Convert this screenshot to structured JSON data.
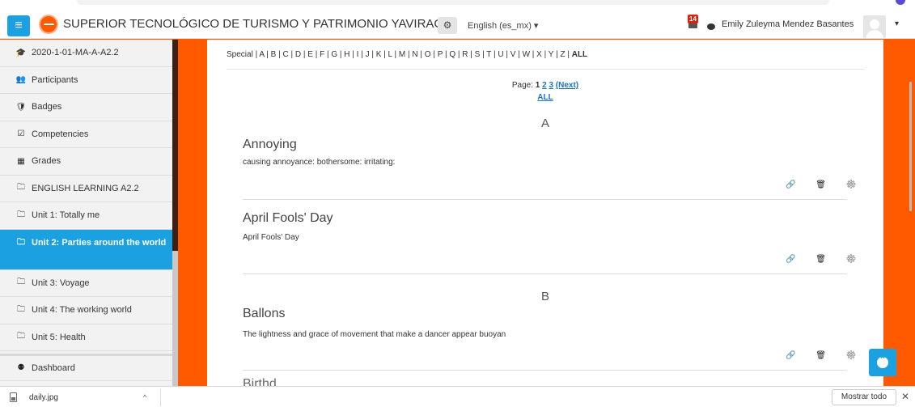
{
  "colors": {
    "accent": "#1ba1e2",
    "background": "#ff5a00",
    "link": "#1b74c9"
  },
  "navbar": {
    "site_name": "SUPERIOR TECNOLÓGICO DE TURISMO Y PATRIMONIO YAVIRAC",
    "language": "English (es_mx) ▾",
    "notification_count": "14",
    "user_name": "Emily Zuleyma Mendez Basantes",
    "menu_icon": "≡",
    "gear_icon": "⚙",
    "caret": "▾"
  },
  "sidebar": {
    "items": [
      {
        "label": "2020-1-01-MA-A-A2.2",
        "icon": "🎓"
      },
      {
        "label": "Participants",
        "icon": "👥"
      },
      {
        "label": "Badges",
        "icon": "🛡"
      },
      {
        "label": "Competencies",
        "icon": "☑"
      },
      {
        "label": "Grades",
        "icon": "▦"
      },
      {
        "label": "ENGLISH LEARNING A2.2",
        "icon": "🗀"
      },
      {
        "label": "Unit 1: Totally me",
        "icon": "🗀"
      },
      {
        "label": "Unit 2: Parties around the world",
        "icon": "🗀"
      },
      {
        "label": "Unit 3: Voyage",
        "icon": "🗀"
      },
      {
        "label": "Unit 4: The working world",
        "icon": "🗀"
      },
      {
        "label": "Unit 5: Health",
        "icon": "🗀"
      },
      {
        "label": "Dashboard",
        "icon": "⚉"
      }
    ]
  },
  "glossary": {
    "alphabet_prefix": "Special | A | B | C | D | E | F | G | H | I | J | K | L | M | N | O | P | Q | R | S | T | U | V | W | X | Y | Z |",
    "alphabet_all": "ALL",
    "page_label": "Page:",
    "page_current": "1",
    "page_2": "2",
    "page_3": "3",
    "page_next": "(Next)",
    "page_all": "ALL",
    "letter_a": "A",
    "letter_b": "B",
    "entries": [
      {
        "title": "Annoying",
        "definition": "causing annoyance: bothersome: irritating:"
      },
      {
        "title": "April Fools' Day",
        "definition": "April Fools' Day"
      },
      {
        "title": "Ballons",
        "definition": "The lightness and grace of movement that make a dancer appear buoyan"
      }
    ],
    "partial_title": "Birthd",
    "actions": "🔗 🗑 ⚙"
  },
  "download_bar": {
    "file_name": "daily.jpg",
    "caret": "^",
    "show_all": "Mostrar todo",
    "close": "✕"
  },
  "back_to_top": "⌃"
}
